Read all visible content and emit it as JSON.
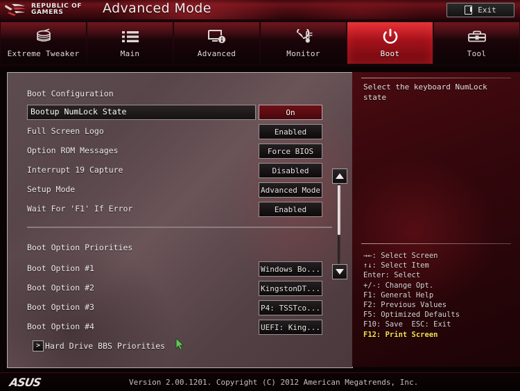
{
  "header": {
    "brand_line1": "REPUBLIC OF",
    "brand_line2": "GAMERS",
    "title": "Advanced Mode",
    "exit_label": "Exit",
    "exit_icon": "exit-door-icon"
  },
  "tabs": [
    {
      "label": "Extreme Tweaker",
      "icon": "tweaker-icon",
      "active": false
    },
    {
      "label": "Main",
      "icon": "list-icon",
      "active": false
    },
    {
      "label": "Advanced",
      "icon": "monitor-info-icon",
      "active": false
    },
    {
      "label": "Monitor",
      "icon": "gauge-thermometer-icon",
      "active": false
    },
    {
      "label": "Boot",
      "icon": "power-icon",
      "active": true
    },
    {
      "label": "Tool",
      "icon": "toolbox-icon",
      "active": false
    }
  ],
  "main": {
    "section1_title": "Boot Configuration",
    "section2_title": "Boot Option Priorities",
    "settings": [
      {
        "label": "Bootup NumLock State",
        "value": "On",
        "selected": true
      },
      {
        "label": "Full Screen Logo",
        "value": "Enabled",
        "selected": false
      },
      {
        "label": "Option ROM Messages",
        "value": "Force BIOS",
        "selected": false
      },
      {
        "label": "Interrupt 19 Capture",
        "value": "Disabled",
        "selected": false
      },
      {
        "label": "Setup Mode",
        "value": "Advanced Mode",
        "selected": false
      },
      {
        "label": "Wait For 'F1' If Error",
        "value": "Enabled",
        "selected": false
      }
    ],
    "boot_options": [
      {
        "label": "Boot Option #1",
        "value": "Windows Bo..."
      },
      {
        "label": "Boot Option #2",
        "value": "KingstonDT..."
      },
      {
        "label": "Boot Option #3",
        "value": "P4: TSSTco..."
      },
      {
        "label": "Boot Option #4",
        "value": "UEFI: King..."
      }
    ],
    "submenu": {
      "label": "Hard Drive BBS Priorities",
      "arrow": ">"
    }
  },
  "help": {
    "description": "Select the keyboard NumLock state",
    "keys": [
      {
        "text": "→←: Select Screen",
        "highlight": false
      },
      {
        "text": "↑↓: Select Item",
        "highlight": false
      },
      {
        "text": "Enter: Select",
        "highlight": false
      },
      {
        "text": "+/-: Change Opt.",
        "highlight": false
      },
      {
        "text": "F1: General Help",
        "highlight": false
      },
      {
        "text": "F2: Previous Values",
        "highlight": false
      },
      {
        "text": "F5: Optimized Defaults",
        "highlight": false
      },
      {
        "text": "F10: Save  ESC: Exit",
        "highlight": false
      },
      {
        "text": "F12: Print Screen",
        "highlight": true
      }
    ]
  },
  "footer": {
    "vendor": "ASUS",
    "version": "Version 2.00.1201. Copyright (C) 2012 American Megatrends, Inc."
  },
  "colors": {
    "accent_red": "#d21820",
    "panel_bg": "#5c4c50",
    "help_bg": "#34070c",
    "highlight_yellow": "#f2e24a",
    "cursor_green": "#6abf5e"
  }
}
